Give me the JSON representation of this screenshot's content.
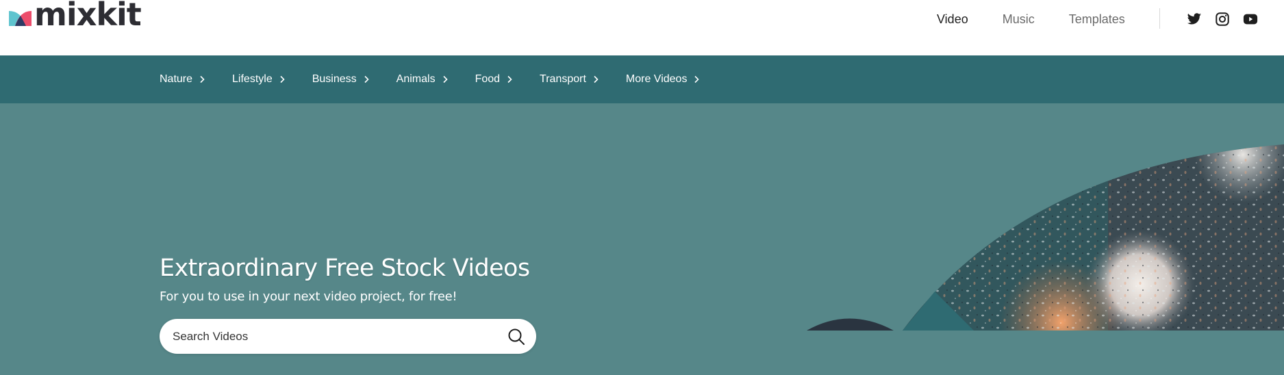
{
  "brand": {
    "name": "mixkit"
  },
  "top_nav": [
    {
      "label": "Video",
      "active": true
    },
    {
      "label": "Music",
      "active": false
    },
    {
      "label": "Templates",
      "active": false
    }
  ],
  "social_icons": [
    "twitter-icon",
    "instagram-icon",
    "youtube-icon"
  ],
  "categories": [
    {
      "label": "Nature"
    },
    {
      "label": "Lifestyle"
    },
    {
      "label": "Business"
    },
    {
      "label": "Animals"
    },
    {
      "label": "Food"
    },
    {
      "label": "Transport"
    },
    {
      "label": "More Videos"
    }
  ],
  "hero": {
    "title": "Extraordinary Free Stock Videos",
    "subtitle": "For you to use in your next video project, for free!",
    "search_placeholder": "Search Videos"
  },
  "colors": {
    "category_bar": "#2f6b72",
    "hero_bg": "#568789",
    "logo_teal": "#5fc4cf",
    "logo_pink": "#ec4d6b",
    "logo_navy": "#2d3a63"
  }
}
